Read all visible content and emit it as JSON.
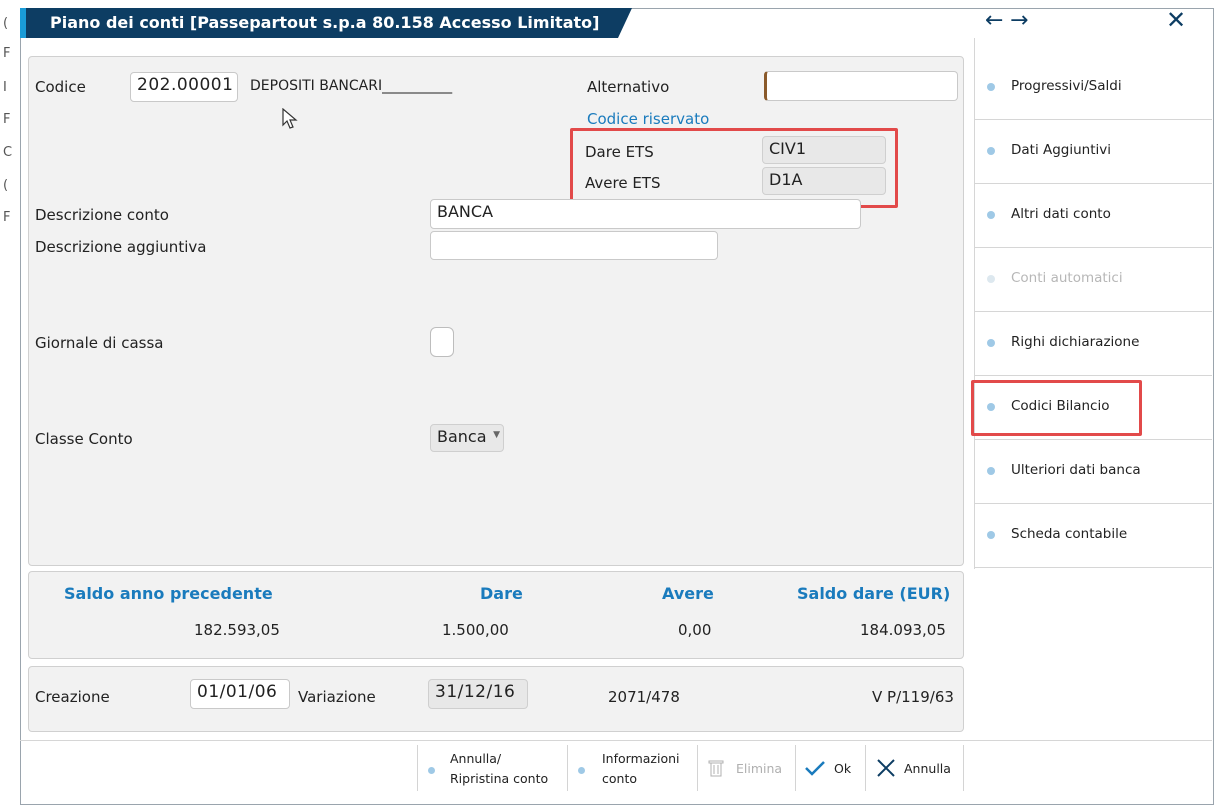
{
  "window": {
    "title": "Piano dei conti  [Passepartout s.p.a 80.158 Accesso Limitato]",
    "nav_back": "←",
    "nav_forward": "→",
    "close": "✕",
    "edge_glyphs": [
      "(",
      "F",
      "I",
      "F",
      "C",
      "(",
      "F"
    ]
  },
  "form": {
    "codice_label": "Codice",
    "codice_value": "202.00001",
    "codice_description": "DEPOSITI BANCARI__________",
    "alternativo_label": "Alternativo",
    "alternativo_value": "",
    "codice_riservato_link": "Codice riservato",
    "dare_ets_label": "Dare ETS",
    "dare_ets_value": "CIV1",
    "avere_ets_label": "Avere ETS",
    "avere_ets_value": "D1A",
    "descrizione_conto_label": "Descrizione conto",
    "descrizione_conto_value": "BANCA",
    "descrizione_aggiuntiva_label": "Descrizione aggiuntiva",
    "descrizione_aggiuntiva_value": "",
    "giornale_cassa_label": "Giornale di cassa",
    "giornale_cassa_checked": false,
    "classe_conto_label": "Classe Conto",
    "classe_conto_value": "Banca"
  },
  "totals": {
    "headers": [
      "Saldo anno precedente",
      "Dare",
      "Avere",
      "Saldo dare (EUR)"
    ],
    "values": [
      "182.593,05",
      "1.500,00",
      "0,00",
      "184.093,05"
    ]
  },
  "dates": {
    "creazione_label": "Creazione",
    "creazione_value": "01/01/06",
    "variazione_label": "Variazione",
    "variazione_value": "31/12/16",
    "ref1": "2071/478",
    "ref2": "V P/119/63"
  },
  "sidebar": {
    "items": [
      {
        "label": "Progressivi/Saldi",
        "enabled": true
      },
      {
        "label": "Dati Aggiuntivi",
        "enabled": true
      },
      {
        "label": "Altri dati conto",
        "enabled": true
      },
      {
        "label": "Conti automatici",
        "enabled": false
      },
      {
        "label": "Righi dichiarazione",
        "enabled": true
      },
      {
        "label": "Codici Bilancio",
        "enabled": true
      },
      {
        "label": "Ulteriori dati banca",
        "enabled": true
      },
      {
        "label": "Scheda contabile",
        "enabled": true
      }
    ]
  },
  "toolbar": {
    "annulla_ripristina_line1": "Annulla/",
    "annulla_ripristina_line2": "Ripristina conto",
    "informazioni_line1": "Informazioni",
    "informazioni_line2": "conto",
    "elimina": "Elimina",
    "ok": "Ok",
    "annulla": "Annulla"
  },
  "colors": {
    "title_bg": "#0d3d63",
    "accent_blue": "#1a7bbd",
    "highlight_red": "#e24a4a"
  }
}
